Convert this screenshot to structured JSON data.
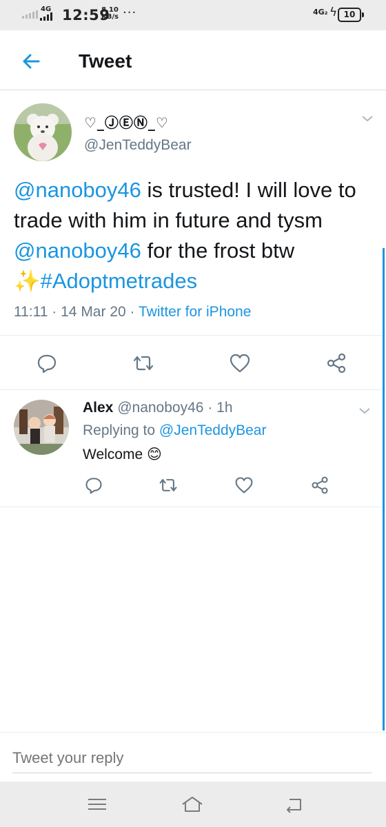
{
  "status_bar": {
    "network": "4G",
    "time": "12:59",
    "speed_value": "8.10",
    "speed_unit": "KB/s",
    "dots": "···",
    "right_network": "4G₂",
    "battery": "10"
  },
  "header": {
    "title": "Tweet"
  },
  "tweet": {
    "display_name": "♡_ⒿⒺⓃ_♡",
    "handle": "@JenTeddyBear",
    "text_parts": {
      "mention1": "@nanoboy46",
      "text1": " is trusted! I will love to trade with him in future and tysm ",
      "mention2": "@nanoboy46",
      "text2": " for the frost btw ",
      "emoji": "✨",
      "hashtag": "#Adoptmetrades"
    },
    "time": "11:11",
    "sep": "·",
    "date": "14 Mar 20",
    "source": "Twitter for iPhone"
  },
  "reply": {
    "name": "Alex",
    "handle": "@nanoboy46",
    "sep": "·",
    "time": "1h",
    "replying_label": "Replying to",
    "replying_to": "@JenTeddyBear",
    "text": "Welcome",
    "emoji": "😊"
  },
  "composer": {
    "placeholder": "Tweet your reply"
  },
  "icons": {
    "reply": "reply-icon",
    "retweet": "retweet-icon",
    "like": "heart-icon",
    "share": "share-icon",
    "back": "back-arrow-icon",
    "menu": "chevron-down-icon"
  },
  "colors": {
    "accent": "#1b95e0",
    "secondary_text": "#657786",
    "primary_text": "#14171a"
  }
}
